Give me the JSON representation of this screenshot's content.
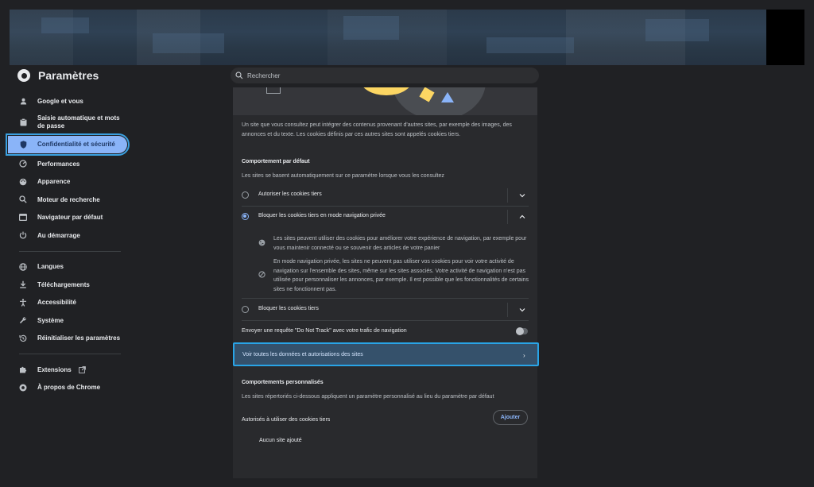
{
  "app": {
    "title": "Paramètres"
  },
  "search": {
    "placeholder": "Rechercher"
  },
  "sidebar": {
    "items": [
      {
        "label": "Google et vous",
        "icon": "person-icon"
      },
      {
        "label": "Saisie automatique et mots de passe",
        "icon": "clipboard-icon"
      },
      {
        "label": "Confidentialité et sécurité",
        "icon": "shield-icon",
        "active": true
      },
      {
        "label": "Performances",
        "icon": "speedometer-icon"
      },
      {
        "label": "Apparence",
        "icon": "palette-icon"
      },
      {
        "label": "Moteur de recherche",
        "icon": "search-icon"
      },
      {
        "label": "Navigateur par défaut",
        "icon": "browser-icon"
      },
      {
        "label": "Au démarrage",
        "icon": "power-icon"
      },
      {
        "label": "Langues",
        "icon": "globe-icon"
      },
      {
        "label": "Téléchargements",
        "icon": "download-icon"
      },
      {
        "label": "Accessibilité",
        "icon": "accessibility-icon"
      },
      {
        "label": "Système",
        "icon": "wrench-icon"
      },
      {
        "label": "Réinitialiser les paramètres",
        "icon": "history-icon"
      },
      {
        "label": "Extensions",
        "icon": "puzzle-icon"
      },
      {
        "label": "À propos de Chrome",
        "icon": "chrome-icon"
      }
    ]
  },
  "main": {
    "intro": "Un site que vous consultez peut intégrer des contenus provenant d'autres sites, par exemple des images, des annonces et du texte. Les cookies définis par ces autres sites sont appelés cookies tiers.",
    "default_heading": "Comportement par défaut",
    "default_sub": "Les sites se basent automatiquement sur ce paramètre lorsque vous les consultez",
    "options": [
      {
        "label": "Autoriser les cookies tiers",
        "checked": false
      },
      {
        "label": "Bloquer les cookies tiers en mode navigation privée",
        "checked": true
      },
      {
        "label": "Bloquer les cookies tiers",
        "checked": false
      }
    ],
    "expanded": {
      "desc1": "Les sites peuvent utiliser des cookies pour améliorer votre expérience de navigation, par exemple pour vous maintenir connecté ou se souvenir des articles de votre panier",
      "desc2": "En mode navigation privée, les sites ne peuvent pas utiliser vos cookies pour voir votre activité de navigation sur l'ensemble des sites, même sur les sites associés. Votre activité de navigation n'est pas utilisée pour personnaliser les annonces, par exemple. Il est possible que les fonctionnalités de certains sites ne fonctionnent pas."
    },
    "dnt_label": "Envoyer une requête \"Do Not Track\" avec votre trafic de navigation",
    "dnt_enabled": false,
    "view_all_label": "Voir toutes les données et autorisations des sites",
    "custom_heading": "Comportements personnalisés",
    "custom_sub": "Les sites répertoriés ci-dessous appliquent un paramètre personnalisé au lieu du paramètre par défaut",
    "allowed_label": "Autorisés à utiliser des cookies tiers",
    "add_button": "Ajouter",
    "empty_label": "Aucun site ajouté"
  },
  "colors": {
    "accent": "#8ab4f8",
    "highlight": "#29a4e6",
    "background": "#202124",
    "card": "#292a2d"
  }
}
